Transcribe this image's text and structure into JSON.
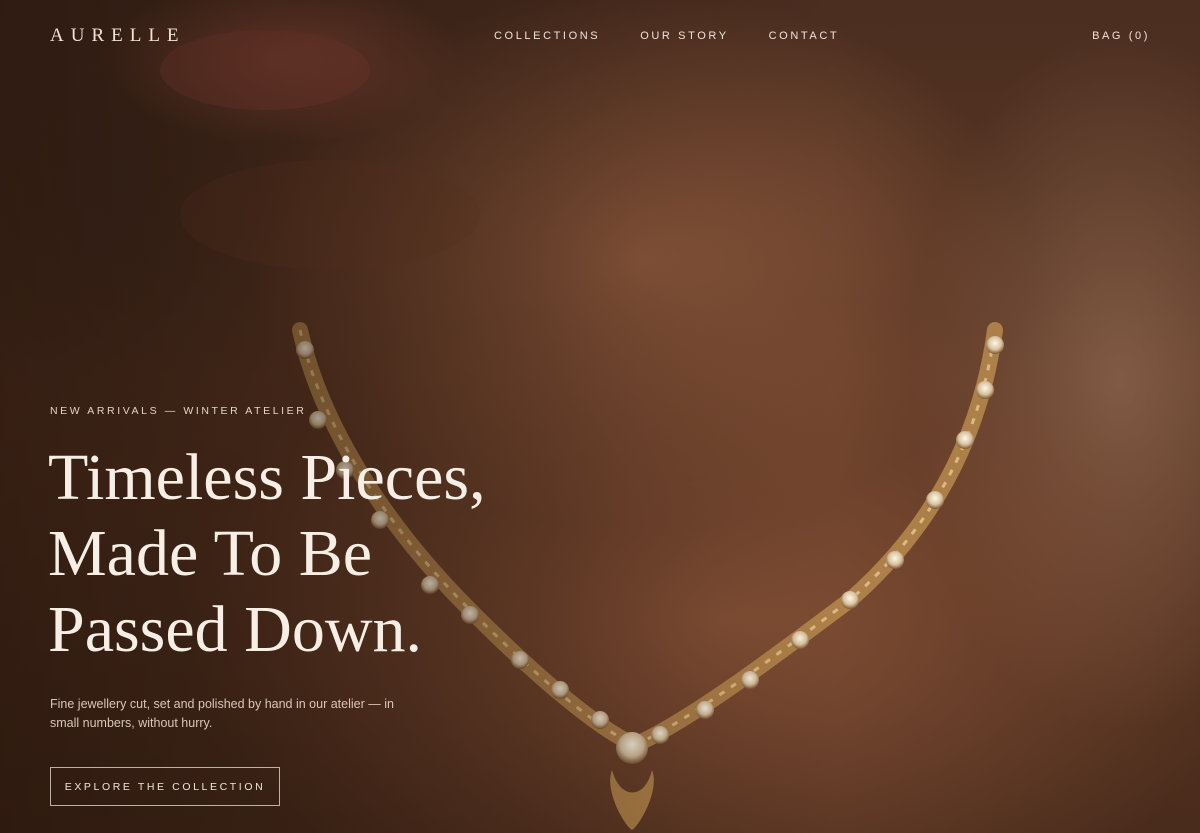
{
  "brand": {
    "logo": "AURELLE"
  },
  "nav": {
    "links": [
      "COLLECTIONS",
      "OUR STORY",
      "CONTACT"
    ],
    "bag": "BAG (0)"
  },
  "hero": {
    "eyebrow": "NEW ARRIVALS — WINTER ATELIER",
    "headline": [
      "Timeless Pieces,",
      "Made To Be",
      "Passed Down."
    ],
    "subtext": "Fine jewellery cut, set and polished by hand in our atelier — in small numbers, without hurry.",
    "cta": "EXPLORE THE COLLECTION"
  },
  "colors": {
    "text": "#f3e9df",
    "background": "#3a2418",
    "gold": "#c9a26a"
  },
  "icons": {
    "necklace": "necklace-illustration"
  }
}
